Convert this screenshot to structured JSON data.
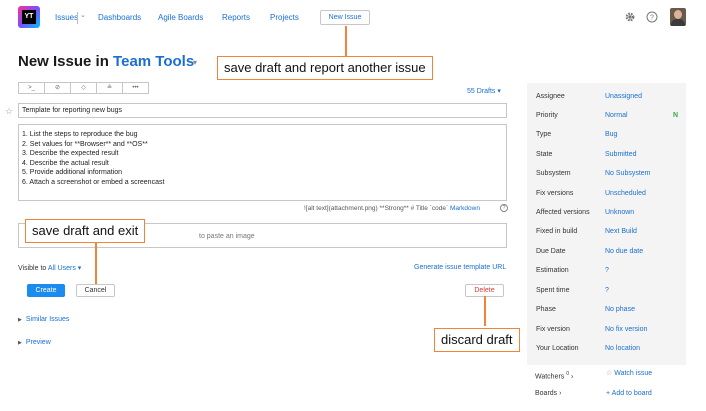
{
  "header": {
    "logo_text": "YT",
    "nav": {
      "issues": "Issues",
      "dashboards": "Dashboards",
      "agile_boards": "Agile Boards",
      "reports": "Reports",
      "projects": "Projects"
    },
    "new_issue_button": "New Issue"
  },
  "page": {
    "title_prefix": "New Issue in ",
    "project_name": "Team Tools"
  },
  "annotations": {
    "save_draft_report": "save draft and report another issue",
    "save_draft_exit": "save draft and exit",
    "discard_draft": "discard draft"
  },
  "toolbar": {
    "buttons": [
      ">_",
      "⊘",
      "◇",
      "≗",
      "•••"
    ],
    "drafts": "55 Drafts"
  },
  "form": {
    "summary": "Template for reporting new bugs",
    "description_lines": [
      "1. List the steps to reproduce the bug",
      "2. Set values for **Browser** and **OS**",
      "3. Describe the expected result",
      "4. Describe the actual result",
      "5. Provide additional information",
      "6. Attach a screenshot or embed a screencast"
    ],
    "markdown_hint": "![alt text](attachment.png) **Strong** # Title `code`",
    "markdown_link": "Markdown",
    "dropzone_text": "to paste an image",
    "visible_to_label": "Visible to",
    "visible_to_value": "All Users",
    "generate_template": "Generate issue template URL",
    "create": "Create",
    "cancel": "Cancel",
    "delete": "Delete",
    "similar_issues": "Similar Issues",
    "preview": "Preview"
  },
  "fields": [
    {
      "label": "Assignee",
      "value": "Unassigned"
    },
    {
      "label": "Priority",
      "value": "Normal"
    },
    {
      "label": "Type",
      "value": "Bug"
    },
    {
      "label": "State",
      "value": "Submitted"
    },
    {
      "label": "Subsystem",
      "value": "No Subsystem"
    },
    {
      "label": "Fix versions",
      "value": "Unscheduled"
    },
    {
      "label": "Affected versions",
      "value": "Unknown"
    },
    {
      "label": "Fixed in build",
      "value": "Next Build"
    },
    {
      "label": "Due Date",
      "value": "No due date"
    },
    {
      "label": "Estimation",
      "value": "?"
    },
    {
      "label": "Spent time",
      "value": "?"
    },
    {
      "label": "Phase",
      "value": "No phase"
    },
    {
      "label": "Fix version",
      "value": "No fix version"
    },
    {
      "label": "Your Location",
      "value": "No location"
    }
  ],
  "priority_badge": "N",
  "watchers": {
    "label": "Watchers",
    "count": "0",
    "link": "Watch issue"
  },
  "boards": {
    "label": "Boards",
    "link": "Add to board"
  },
  "colors": {
    "accent": "#1a6fd1",
    "primary_button": "#1a8cf0",
    "callout_border": "#f0843a",
    "delete": "#d63b3b",
    "panel_bg": "#f4f4f4"
  }
}
